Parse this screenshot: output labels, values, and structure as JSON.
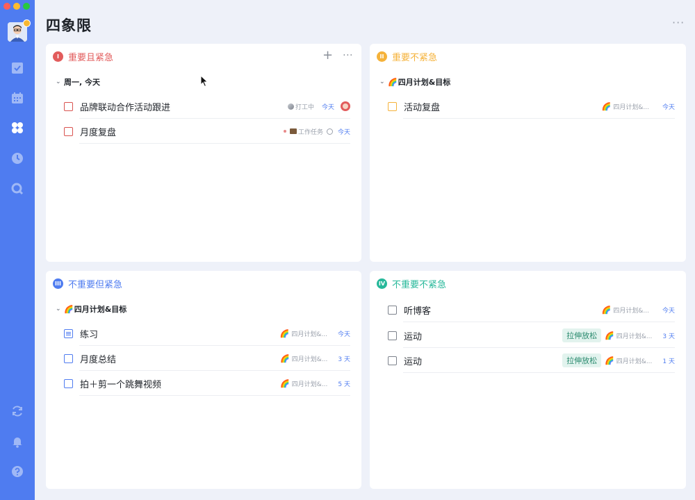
{
  "window": {
    "title": "四象限"
  },
  "sidebar": {
    "items": [
      {
        "name": "task-icon"
      },
      {
        "name": "calendar-icon"
      },
      {
        "name": "quadrant-icon"
      },
      {
        "name": "pomodoro-icon"
      },
      {
        "name": "search-icon"
      },
      {
        "name": "sync-icon"
      },
      {
        "name": "notification-icon"
      },
      {
        "name": "help-icon"
      }
    ],
    "accent_color": "#4f7cf0"
  },
  "quadrants": [
    {
      "roman": "I",
      "title": "重要且紧急",
      "color": "#e25c5c",
      "groups": [
        {
          "label": "周一, 今天",
          "tasks": [
            {
              "title": "品牌联动合作活动跟进",
              "list": "打工中",
              "due": "今天"
            },
            {
              "title": "月度复盘",
              "list": "工作任务",
              "due": "今天"
            }
          ]
        }
      ]
    },
    {
      "roman": "II",
      "title": "重要不紧急",
      "color": "#f5b23a",
      "groups": [
        {
          "label": "四月计划&目标",
          "tasks": [
            {
              "title": "活动复盘",
              "list": "四月计划&...",
              "due": "今天"
            }
          ]
        }
      ]
    },
    {
      "roman": "III",
      "title": "不重要但紧急",
      "color": "#4f7cf0",
      "groups": [
        {
          "label": "四月计划&目标",
          "tasks": [
            {
              "title": "练习",
              "list": "四月计划&...",
              "due": "今天"
            },
            {
              "title": "月度总结",
              "list": "四月计划&...",
              "due": "3 天"
            },
            {
              "title": "拍＋剪一个跳舞视频",
              "list": "四月计划&...",
              "due": "5 天"
            }
          ]
        }
      ]
    },
    {
      "roman": "IV",
      "title": "不重要不紧急",
      "color": "#27b89a",
      "tasks": [
        {
          "title": "听博客",
          "list": "四月计划&...",
          "due": "今天"
        },
        {
          "title": "运动",
          "tag": "拉伸放松",
          "list": "四月计划&...",
          "due": "3 天"
        },
        {
          "title": "运动",
          "tag": "拉伸放松",
          "list": "四月计划&...",
          "due": "1 天"
        }
      ]
    }
  ]
}
